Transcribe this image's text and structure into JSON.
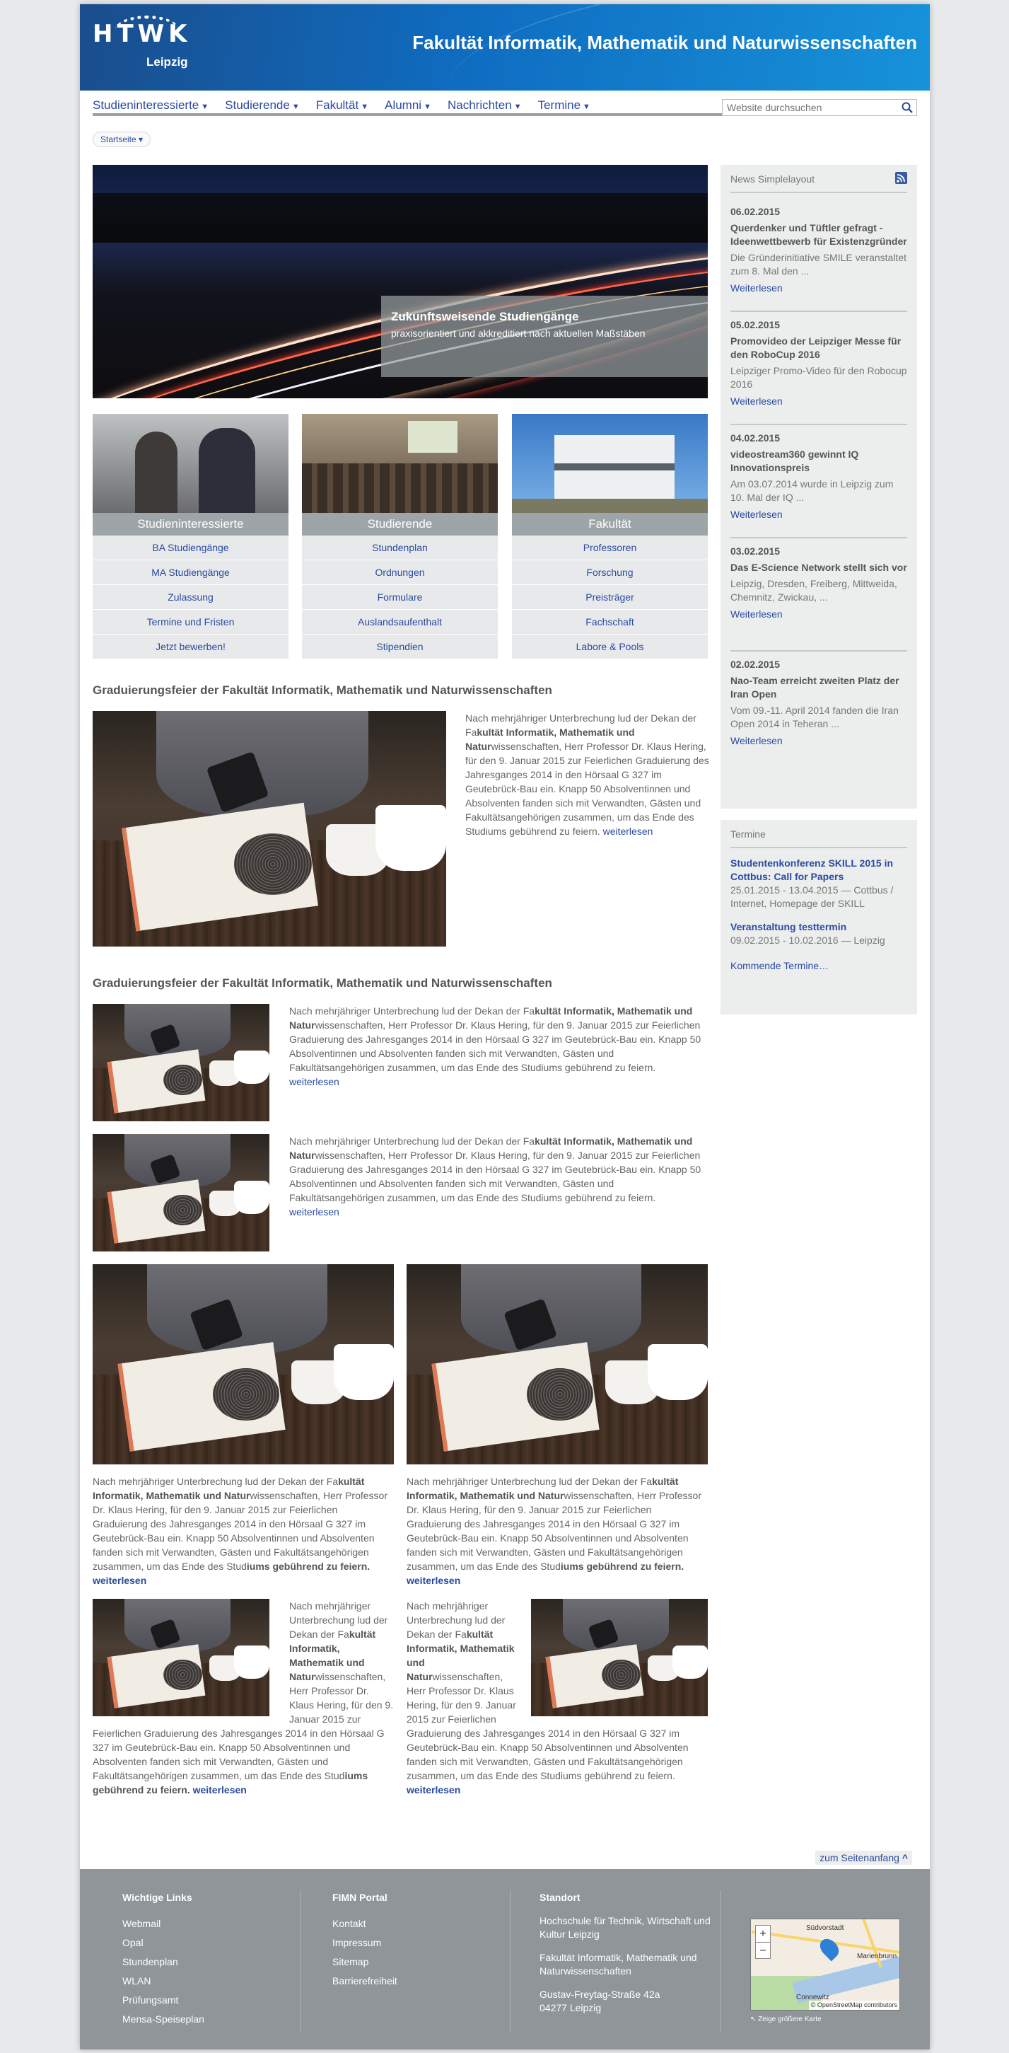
{
  "header": {
    "logo_text": "HTWK",
    "logo_sub": "Leipzig",
    "title": "Fakultät Informatik, Mathematik und Naturwissenschaften"
  },
  "nav": {
    "items": [
      "Studieninteressierte",
      "Studierende",
      "Fakultät",
      "Alumni",
      "Nachrichten",
      "Termine"
    ],
    "search_placeholder": "Website durchsuchen"
  },
  "breadcrumb": "Startseite ▾",
  "hero": {
    "title": "Zukunftsweisende Studiengänge",
    "subtitle": "praxisorientiert und akkreditiert nach aktuellen Maßstäben"
  },
  "tiles": [
    {
      "label": "Studieninteressierte",
      "links": [
        "BA Studiengänge",
        "MA Studiengänge",
        "Zulassung",
        "Termine und Fristen",
        "Jetzt bewerben!"
      ]
    },
    {
      "label": "Studierende",
      "links": [
        "Stundenplan",
        "Ordnungen",
        "Formulare",
        "Auslandsaufenthalt",
        "Stipendien"
      ]
    },
    {
      "label": "Fakultät",
      "links": [
        "Professoren",
        "Forschung",
        "Preisträger",
        "Fachschaft",
        "Labore & Pools"
      ]
    }
  ],
  "article": {
    "heading": "Graduierungsfeier der Fakultät Informatik, Mathematik und Naturwissenschaften",
    "text_pre": "Nach mehrjähriger Unterbrechung lud der Dekan der Fa",
    "text_bold": "kultät Informatik, Mathematik und Natur",
    "text_post": "wissenschaften, Herr Professor Dr. Klaus Hering, für den 9. Januar 2015 zur Feierlichen Graduierung des Jahresganges 2014 in den Hörsaal G 327 im Geutebrück-Bau ein. Knapp 50 Absolventinnen und Absolventen fanden sich mit Verwandten, Gästen und Fakultätsangehörigen zusammen, um das Ende des Studiums gebührend zu feiern.",
    "text_post_a": "wissenschaften, Herr Professor Dr. Klaus Hering, für den 9. Januar 2015 zur Feierlichen Graduierung des Jahresganges 2014 in den Hörsaal G 327 im Geutebrück-Bau ein. Knapp 50 Absolventinnen und Absolventen fanden sich mit Verwandten, Gästen und Fakultätsangehörigen zusammen, um das Ende des Stud",
    "text_bold_end": "iums gebührend zu feiern.",
    "more": "weiterlesen"
  },
  "news": {
    "title": "News Simplelayout",
    "items": [
      {
        "date": "06.02.2015",
        "headline": "Querdenker und Tüftler gefragt - Ideenwettbewerb für Existenzgründer",
        "teaser": "Die Gründerinitiative SMILE veranstaltet zum 8. Mal den ...",
        "more": "Weiterlesen"
      },
      {
        "date": "05.02.2015",
        "headline": "Promovideo der Leipziger Messe für den RoboCup 2016",
        "teaser": "Leipziger Promo-Video für den Robocup 2016",
        "more": "Weiterlesen"
      },
      {
        "date": "04.02.2015",
        "headline": "videostream360 gewinnt IQ Innovationspreis",
        "teaser": "Am 03.07.2014 wurde in Leipzig zum 10. Mal der IQ ...",
        "more": "Weiterlesen"
      },
      {
        "date": "03.02.2015",
        "headline": "Das E-Science Network stellt sich vor",
        "teaser": "Leipzig, Dresden, Freiberg, Mittweida, Chemnitz, Zwickau, ...",
        "more": "Weiterlesen"
      },
      {
        "date": "02.02.2015",
        "headline": "Nao-Team erreicht zweiten Platz der Iran Open",
        "teaser": "Vom 09.-11. April 2014 fanden die Iran Open 2014 in Teheran ...",
        "more": "Weiterlesen"
      }
    ]
  },
  "events": {
    "title": "Termine",
    "items": [
      {
        "title": "Studentenkonferenz SKILL 2015 in Cottbus: Call for Papers",
        "detail": "25.01.2015 - 13.04.2015 — Cottbus / Internet, Homepage der SKILL"
      },
      {
        "title": "Veranstaltung testtermin",
        "detail": "09.02.2015 - 10.02.2016 — Leipzig"
      }
    ],
    "more": "Kommende Termine…"
  },
  "to_top": "zum Seitenanfang",
  "footer": {
    "links_title": "Wichtige Links",
    "links": [
      "Webmail",
      "Opal",
      "Stundenplan",
      "WLAN",
      "Prüfungsamt",
      "Mensa-Speiseplan"
    ],
    "portal_title": "FIMN Portal",
    "portal": [
      "Kontakt",
      "Impressum",
      "Sitemap",
      "Barrierefreiheit"
    ],
    "location_title": "Standort",
    "addr1": "Hochschule für Technik, Wirtschaft und Kultur Leipzig",
    "addr2": "Fakultät Informatik, Mathematik und Naturwissenschaften",
    "addr3": "Gustav-Freytag-Straße 42a",
    "addr4": "04277 Leipzig",
    "map_link": "Zeige größere Karte",
    "map_labels": [
      "Südvorstadt",
      "Marienbrunn",
      "Connewitz"
    ],
    "map_attr": "© OpenStreetMap contributors"
  }
}
